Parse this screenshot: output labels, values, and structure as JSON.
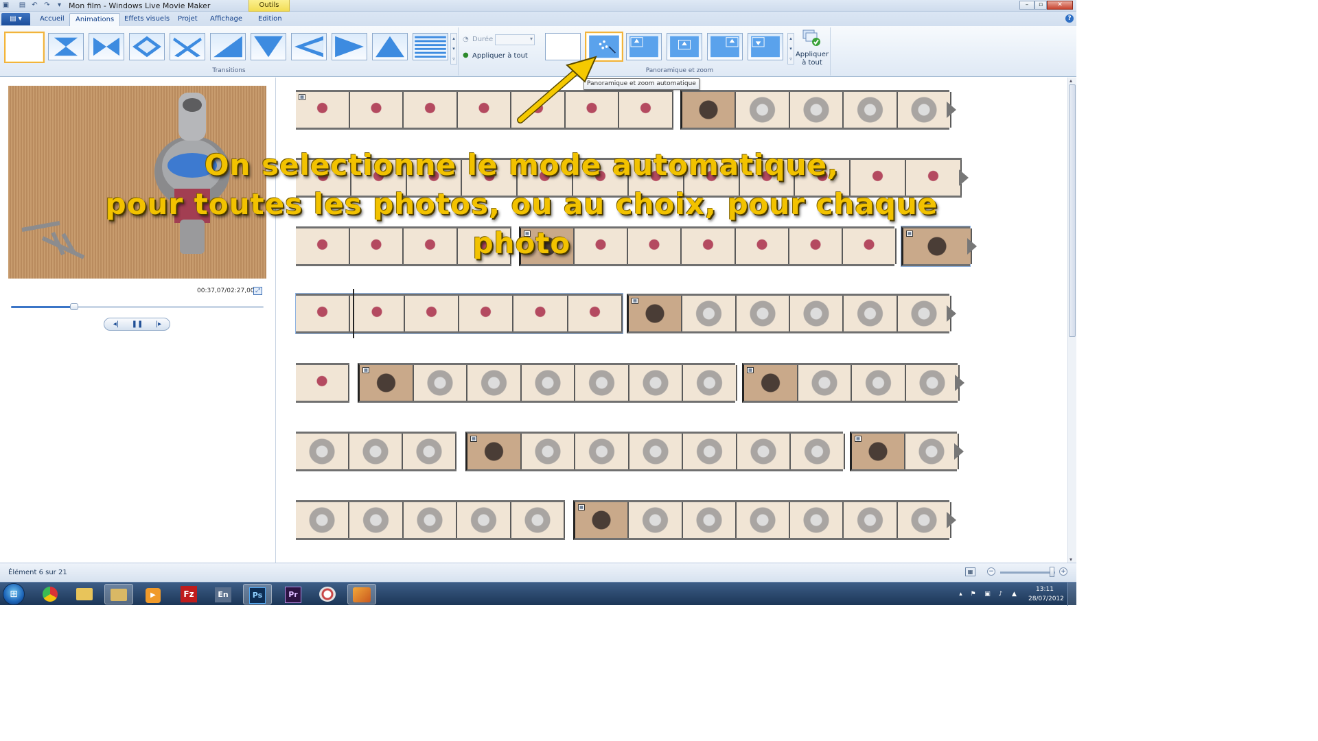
{
  "window": {
    "title": "Mon film - Windows Live Movie Maker",
    "context_tab": "Outils vidéo"
  },
  "tabs": [
    "Accueil",
    "Animations",
    "Effets visuels",
    "Projet",
    "Affichage",
    "Edition"
  ],
  "active_tab": "Animations",
  "ribbon": {
    "transitions_label": "Transitions",
    "duree_label": "Durée :",
    "duree_value": "",
    "apply_all_label": "Appliquer à tout",
    "pan_zoom_label": "Panoramique et zoom",
    "apply_all_big_line1": "Appliquer",
    "apply_all_big_line2": "à tout"
  },
  "tooltip": "Panoramique et zoom automatique",
  "preview": {
    "time": "00:37,07/02:27,00",
    "progress": 0.25
  },
  "caption": {
    "line1": "On selectionne le mode automatique,",
    "line2": "pour toutes les photos, ou au choix, pour chaque photo",
    "color": "#f2c200"
  },
  "status": {
    "text": "Élément 6 sur 21",
    "zoom_level": 0.95
  },
  "taskbar": {
    "apps": [
      "chrome",
      "explorer",
      "media-player",
      "FZ",
      "En",
      "Ps",
      "Pr",
      "paint",
      "movie-maker"
    ],
    "time": "13:11",
    "date": "28/07/2012"
  },
  "colors": {
    "accent": "#1b4e9b",
    "selection": "#f2b33c",
    "arrow": "#f5c900"
  }
}
